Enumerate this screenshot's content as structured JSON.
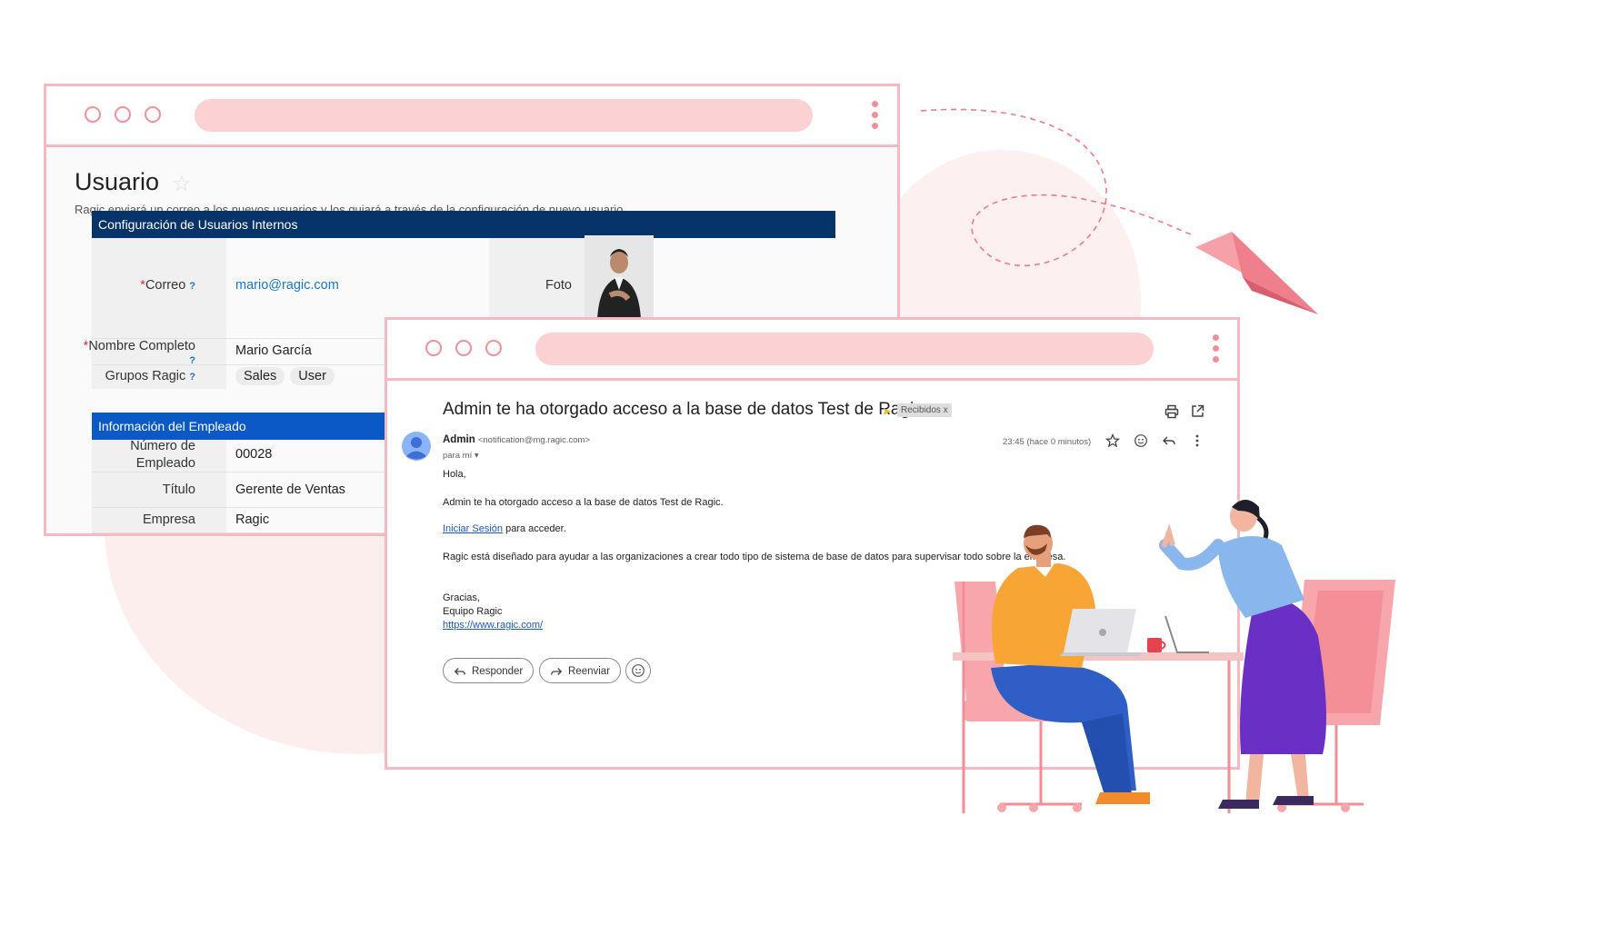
{
  "user_window": {
    "title": "Usuario",
    "subtitle": "Ragic enviará un correo a los nuevos usuarios y los guiará a través de la configuración de nuevo usuario.",
    "section1": {
      "title": "Configuración de Usuarios Internos",
      "color": "#07336b",
      "fields": [
        {
          "label": "Correo",
          "required": true,
          "help": "?",
          "value": "mario@ragic.com"
        },
        {
          "label": "Nombre Completo",
          "required": true,
          "help": "?",
          "value": "Mario García"
        },
        {
          "label": "Grupos Ragic",
          "help": "?",
          "chips": [
            "Sales",
            "User"
          ]
        }
      ],
      "photo_label": "Foto"
    },
    "section2": {
      "title": "Información del Empleado",
      "color": "#0a59c4",
      "fields": [
        {
          "label_line1": "Número de",
          "label_line2": "Empleado",
          "value": "00028"
        },
        {
          "label": "Título",
          "value": "Gerente de Ventas"
        },
        {
          "label": "Empresa",
          "value": "Ragic"
        }
      ]
    }
  },
  "email": {
    "subject": "Admin te ha otorgado acceso a la base de datos Test de Ragic",
    "label_tag": "Recibidos",
    "label_tag_close": "x",
    "sender_name": "Admin",
    "sender_email": "<notification@mg.ragic.com>",
    "recipient": "para mí",
    "timestamp": "23:45 (hace 0 minutos)",
    "greeting": "Hola,",
    "line1": "Admin te ha otorgado acceso a la base de datos Test de Ragic.",
    "login_link": "Iniciar Sesión",
    "login_suffix": " para acceder.",
    "line3": "Ragic está diseñado para ayudar a las organizaciones a crear todo tipo de sistema de base de datos para supervisar todo sobre la empresa.",
    "closing": "Gracias,",
    "signature": "Equipo Ragic",
    "site_link": "https://www.ragic.com/",
    "reply_label": "Responder",
    "forward_label": "Reenviar"
  },
  "colors": {
    "window_border": "#f7b9bf",
    "accent_pink": "#f38f98",
    "link_blue": "#1a57c8"
  }
}
